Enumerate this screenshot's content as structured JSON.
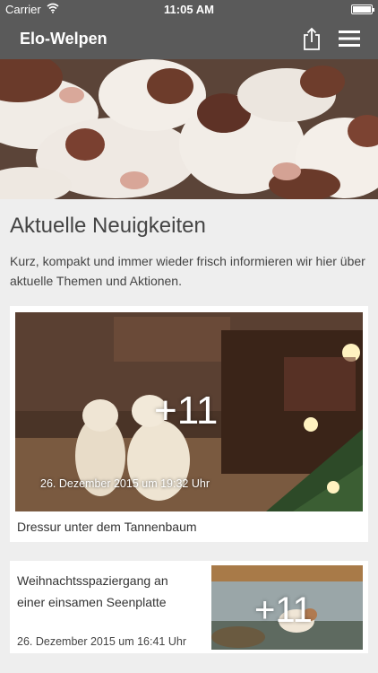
{
  "status": {
    "carrier": "Carrier",
    "time": "11:05 AM"
  },
  "nav": {
    "title": "Elo-Welpen",
    "share_icon": "share-icon",
    "menu_icon": "hamburger-menu-icon"
  },
  "news": {
    "headline": "Aktuelle Neuigkeiten",
    "intro": "Kurz, kompakt und immer wieder frisch informieren wir hier über aktuelle Themen und Aktionen."
  },
  "posts": [
    {
      "counter": "+11",
      "date": "26. Dezember 2015 um 19:32 Uhr",
      "caption": "Dressur unter dem Tannenbaum"
    },
    {
      "counter": "+11",
      "date": "26. Dezember 2015 um 16:41 Uhr",
      "caption": "Weihnachtsspaziergang an einer einsamen Seenplatte"
    }
  ],
  "colors": {
    "bar": "#5a5a5a",
    "background": "#eeeeee",
    "card": "#ffffff"
  }
}
